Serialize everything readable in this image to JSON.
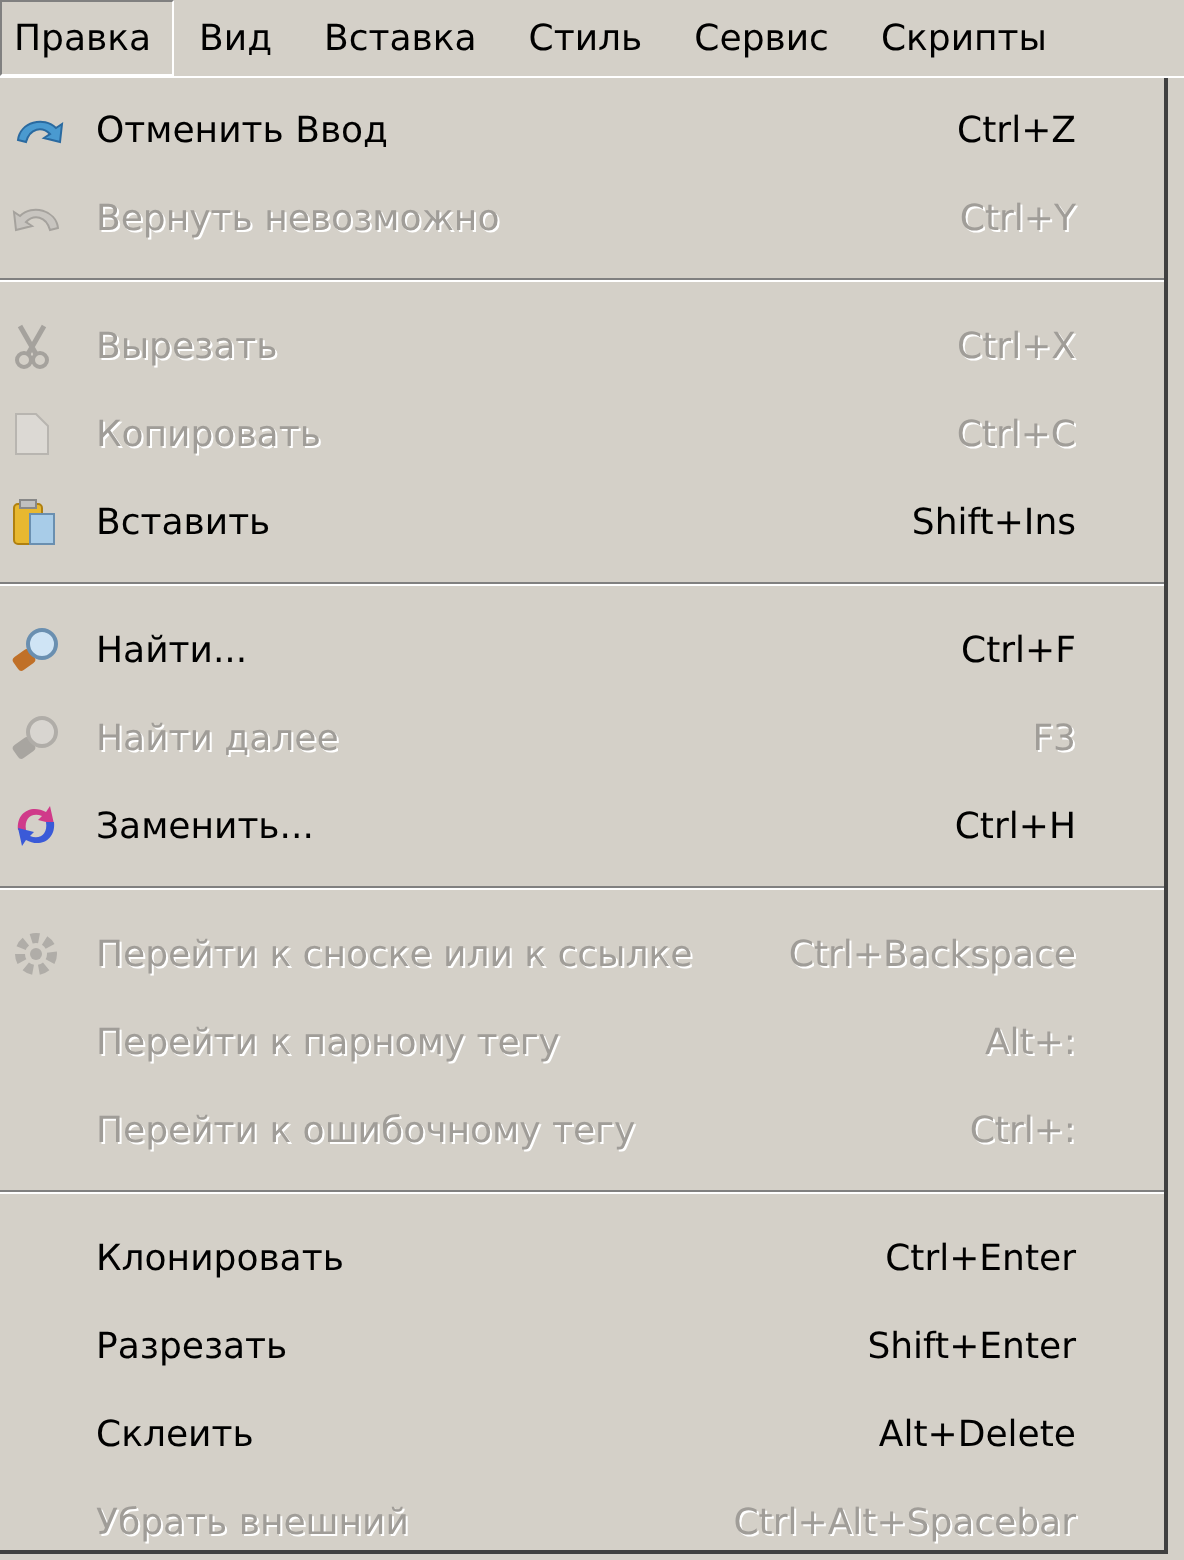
{
  "menubar": [
    {
      "label": "Правка",
      "selected": true
    },
    {
      "label": "Вид",
      "selected": false
    },
    {
      "label": "Вставка",
      "selected": false
    },
    {
      "label": "Стиль",
      "selected": false
    },
    {
      "label": "Сервис",
      "selected": false
    },
    {
      "label": "Скрипты",
      "selected": false
    }
  ],
  "menu": {
    "groups": [
      {
        "items": [
          {
            "kind": "undo",
            "label": "Отменить Ввод",
            "shortcut": "Ctrl+Z",
            "disabled": false
          },
          {
            "kind": "redo",
            "label": "Вернуть невозможно",
            "shortcut": "Ctrl+Y",
            "disabled": true
          }
        ]
      },
      {
        "items": [
          {
            "kind": "cut",
            "label": "Вырезать",
            "shortcut": "Ctrl+X",
            "disabled": true
          },
          {
            "kind": "copy",
            "label": "Копировать",
            "shortcut": "Ctrl+C",
            "disabled": true
          },
          {
            "kind": "paste",
            "label": "Вставить",
            "shortcut": "Shift+Ins",
            "disabled": false
          }
        ]
      },
      {
        "items": [
          {
            "kind": "find",
            "label": "Найти...",
            "shortcut": "Ctrl+F",
            "disabled": false
          },
          {
            "kind": "find",
            "label": "Найти далее",
            "shortcut": "F3",
            "disabled": true
          },
          {
            "kind": "replace",
            "label": "Заменить...",
            "shortcut": "Ctrl+H",
            "disabled": false
          }
        ]
      },
      {
        "items": [
          {
            "kind": "goto",
            "label": "Перейти к сноске или к ссылке",
            "shortcut": "Ctrl+Backspace",
            "disabled": true
          },
          {
            "kind": "plain",
            "label": "Перейти к парному тегу",
            "shortcut": "Alt+:",
            "disabled": true
          },
          {
            "kind": "plain",
            "label": "Перейти к ошибочному тегу",
            "shortcut": "Ctrl+:",
            "disabled": true
          }
        ]
      },
      {
        "items": [
          {
            "kind": "plain",
            "label": "Клонировать",
            "shortcut": "Ctrl+Enter",
            "disabled": false
          },
          {
            "kind": "plain",
            "label": "Разрезать",
            "shortcut": "Shift+Enter",
            "disabled": false
          },
          {
            "kind": "plain",
            "label": "Склеить",
            "shortcut": "Alt+Delete",
            "disabled": false
          },
          {
            "kind": "plain",
            "label": "Убрать внешний",
            "shortcut": "Ctrl+Alt+Spacebar",
            "disabled": true
          }
        ]
      }
    ]
  }
}
